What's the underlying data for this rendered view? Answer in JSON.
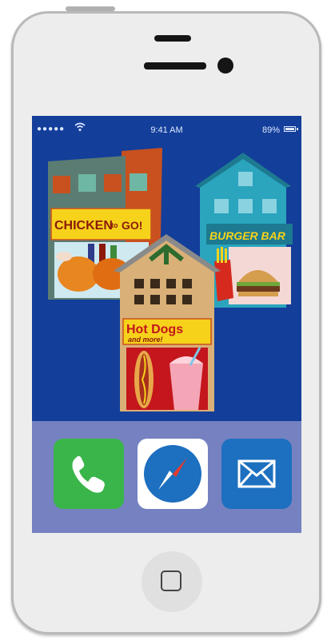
{
  "status_bar": {
    "signal": "●●●●●",
    "time": "9:41 AM",
    "battery": "89%"
  },
  "restaurants": {
    "chicken": {
      "sign_main": "CHICKEN",
      "sign_mid": "to",
      "sign_end": "GO!"
    },
    "burger": {
      "sign": "BURGER BAR"
    },
    "hotdogs": {
      "sign_main": "Hot Dogs",
      "sign_sub": "and more!"
    }
  },
  "dock": {
    "apps": [
      {
        "name": "Phone",
        "icon": "phone-icon",
        "color": "#3ab54a"
      },
      {
        "name": "Safari",
        "icon": "compass-icon",
        "color": "#ffffff"
      },
      {
        "name": "Mail",
        "icon": "envelope-icon",
        "color": "#1d6fbf"
      }
    ]
  },
  "colors": {
    "screen_bg": "#133e9a",
    "dock_bg": "#7581c0",
    "phone_body": "#ededed"
  }
}
